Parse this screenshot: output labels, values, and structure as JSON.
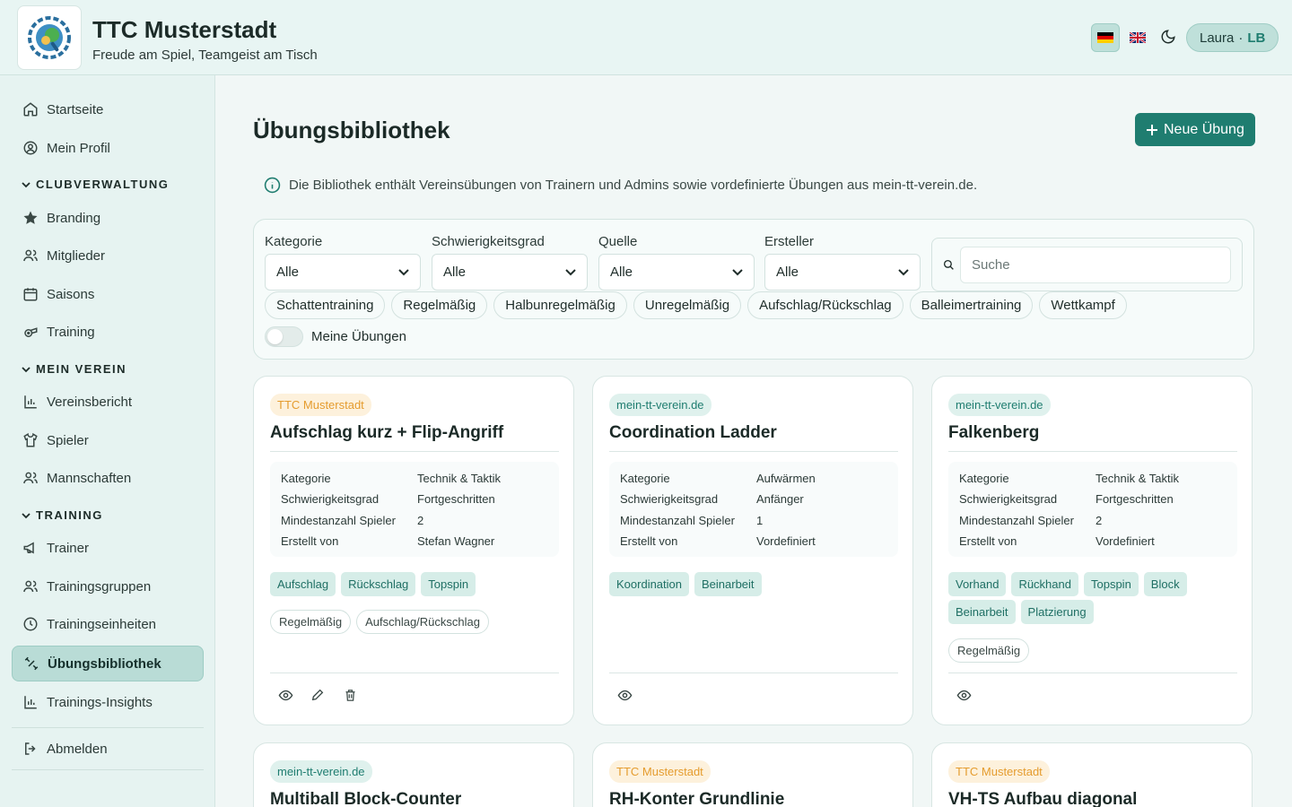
{
  "header": {
    "club_name": "TTC Musterstadt",
    "slogan": "Freude am Spiel, Teamgeist am Tisch",
    "user_name": "Laura",
    "user_sep": "·",
    "user_initials": "LB"
  },
  "sidebar": {
    "items_top": [
      {
        "label": "Startseite",
        "icon": "home-icon"
      },
      {
        "label": "Mein Profil",
        "icon": "user-circle-icon"
      }
    ],
    "section_club": "CLUBVERWALTUNG",
    "items_club": [
      {
        "label": "Branding",
        "icon": "star-icon"
      },
      {
        "label": "Mitglieder",
        "icon": "users-icon"
      },
      {
        "label": "Saisons",
        "icon": "calendar-icon"
      },
      {
        "label": "Training",
        "icon": "whistle-icon"
      }
    ],
    "section_verein": "MEIN VEREIN",
    "items_verein": [
      {
        "label": "Vereinsbericht",
        "icon": "chart-icon"
      },
      {
        "label": "Spieler",
        "icon": "shirt-icon"
      },
      {
        "label": "Mannschaften",
        "icon": "users-icon"
      }
    ],
    "section_training": "TRAINING",
    "items_training": [
      {
        "label": "Trainer",
        "icon": "megaphone-icon"
      },
      {
        "label": "Trainingsgruppen",
        "icon": "users-icon"
      },
      {
        "label": "Trainingseinheiten",
        "icon": "clock-icon"
      },
      {
        "label": "Übungsbibliothek",
        "icon": "dumbbell-icon"
      },
      {
        "label": "Trainings-Insights",
        "icon": "chart-icon"
      }
    ],
    "logout": "Abmelden"
  },
  "main": {
    "title": "Übungsbibliothek",
    "new_button": "Neue Übung",
    "info_text": "Die Bibliothek enthält Vereinsübungen von Trainern und Admins sowie vordefinierte Übungen aus mein-tt-verein.de."
  },
  "filters": {
    "kategorie_label": "Kategorie",
    "kategorie_value": "Alle",
    "schwierigkeit_label": "Schwierigkeitsgrad",
    "schwierigkeit_value": "Alle",
    "quelle_label": "Quelle",
    "quelle_value": "Alle",
    "ersteller_label": "Ersteller",
    "ersteller_value": "Alle",
    "search_placeholder": "Suche",
    "chips": [
      "Schattentraining",
      "Regelmäßig",
      "Halbunregelmäßig",
      "Unregelmäßig",
      "Aufschlag/Rückschlag",
      "Balleimertraining",
      "Wettkampf"
    ],
    "toggle_label": "Meine Übungen",
    "toggle_on": false
  },
  "meta_labels": {
    "kategorie": "Kategorie",
    "schwierigkeit": "Schwierigkeitsgrad",
    "spieler": "Mindestanzahl Spieler",
    "erstellt": "Erstellt von"
  },
  "cards": [
    {
      "source": "TTC Musterstadt",
      "title": "Aufschlag kurz + Flip-Angriff",
      "kategorie": "Technik & Taktik",
      "schwierigkeit": "Fortgeschritten",
      "spieler": "2",
      "erstellt": "Stefan Wagner",
      "tags": [
        "Aufschlag",
        "Rückschlag",
        "Topspin"
      ],
      "types": [
        "Regelmäßig",
        "Aufschlag/Rückschlag"
      ]
    },
    {
      "source": "mein-tt-verein.de",
      "title": "Coordination Ladder",
      "kategorie": "Aufwärmen",
      "schwierigkeit": "Anfänger",
      "spieler": "1",
      "erstellt": "Vordefiniert",
      "tags": [
        "Koordination",
        "Beinarbeit"
      ],
      "types": []
    },
    {
      "source": "mein-tt-verein.de",
      "title": "Falkenberg",
      "kategorie": "Technik & Taktik",
      "schwierigkeit": "Fortgeschritten",
      "spieler": "2",
      "erstellt": "Vordefiniert",
      "tags": [
        "Vorhand",
        "Rückhand",
        "Topspin",
        "Block",
        "Beinarbeit",
        "Platzierung"
      ],
      "types": [
        "Regelmäßig"
      ]
    },
    {
      "source": "mein-tt-verein.de",
      "title": "Multiball Block-Counter"
    },
    {
      "source": "TTC Musterstadt",
      "title": "RH-Konter Grundlinie"
    },
    {
      "source": "TTC Musterstadt",
      "title": "VH-TS Aufbau diagonal"
    }
  ],
  "colors": {
    "accent": "#1f7d70",
    "club_badge": "#e59c2e",
    "web_badge": "#1f7d70"
  }
}
